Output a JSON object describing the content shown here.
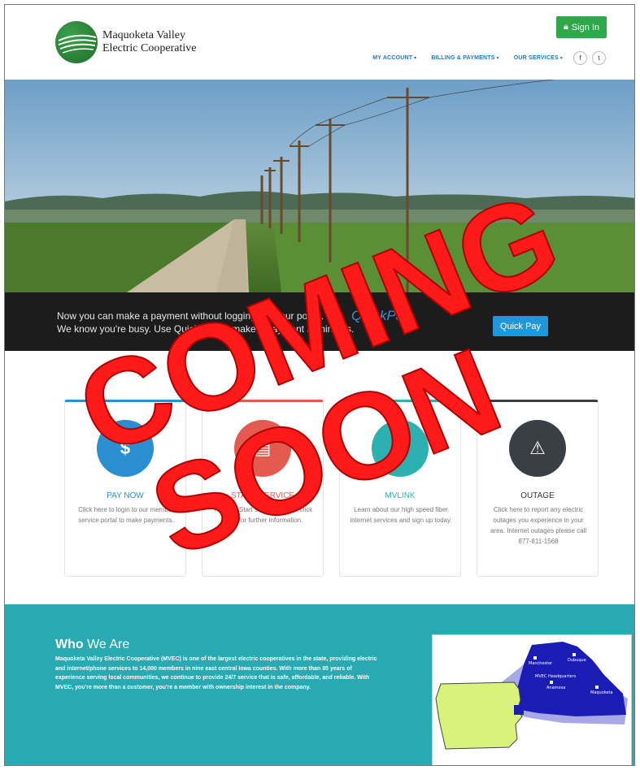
{
  "header": {
    "logo_line1": "Maquoketa Valley",
    "logo_line2": "Electric Cooperative",
    "signin_label": "Sign In",
    "nav": [
      "MY ACCOUNT",
      "BILLING & PAYMENTS",
      "OUR SERVICES"
    ],
    "social": [
      "f",
      "t"
    ]
  },
  "band": {
    "line1": "Now you can make a payment without logging in to our portal.",
    "line2": "We know you're busy. Use Quick Pay to make a payment in minutes.",
    "brand": "QuickPay",
    "button_label": "Quick Pay"
  },
  "cards": [
    {
      "title": "PAY NOW",
      "icon": "dollar-icon",
      "glyph": "$",
      "desc": "Click here to login to our member service portal to make payments.",
      "color": "#2a8fd1"
    },
    {
      "title": "START SERVICE",
      "icon": "document-icon",
      "glyph": "▤",
      "desc": "Need to Start service, please click here for further information.",
      "color": "#e55a4e"
    },
    {
      "title": "MVLINK",
      "icon": "wifi-icon",
      "glyph": "◠",
      "desc": "Learn about our high speed fiber internet services and sign up today.",
      "color": "#2db1b0"
    },
    {
      "title": "OUTAGE",
      "icon": "warning-icon",
      "glyph": "⚠",
      "desc": "Click here to report any electric outages you experience in your area. Internet outages please call 877-811-1568",
      "color": "#3a3f46"
    }
  ],
  "who": {
    "title_strong": "Who",
    "title_rest": " We Are",
    "text": "Maquoketa Valley Electric Cooperative (MVEC) is one of the largest electric cooperatives in the state, providing electric and internet/phone services to 14,000 members in nine east central Iowa counties. With more than 85 years of experience serving local communities, we continue to provide 24/7 service that is safe, affordable, and reliable. With MVEC, you're more than a customer, you're a member with ownership interest in the company."
  },
  "map": {
    "labels": [
      "Manchester",
      "Dubuque",
      "MVEC Headquarters",
      "Anamosa",
      "Maquoketa"
    ]
  },
  "overlay": {
    "line1": "COMING",
    "line2": "SOON",
    "color": "#ff1a1a"
  },
  "colors": {
    "signin": "#2ea84b",
    "nav": "#1d77c5",
    "teal": "#29a9b1",
    "quickpay": "#2197d9"
  }
}
